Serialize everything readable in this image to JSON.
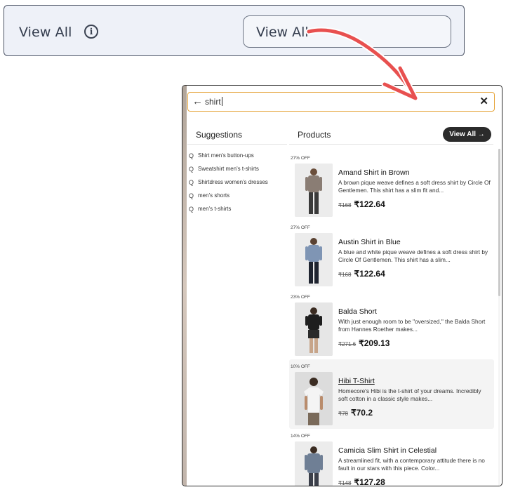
{
  "setting": {
    "label": "View All",
    "info_icon": "info-circle-icon",
    "preview_button_label": "View All"
  },
  "annotation": {
    "arrow_color": "#e8504f",
    "arrow_icon": "curved-arrow-icon"
  },
  "search": {
    "back_icon": "←",
    "value": "shirt",
    "clear_icon": "✕"
  },
  "suggestions": {
    "title": "Suggestions",
    "icon": "Q",
    "items": [
      "Shirt men's button-ups",
      "Sweatshirt men's t-shirts",
      "Shirtdress women's dresses",
      "men's shorts",
      "men's t-shirts"
    ]
  },
  "products": {
    "title": "Products",
    "view_all_label": "View All →",
    "items": [
      {
        "discount": "27% OFF",
        "name": "Amand Shirt in Brown",
        "desc": "A brown pique weave defines a soft dress shirt by Circle Of Gentlemen. This shirt has a slim fit and...",
        "old_price": "₹168",
        "new_price": "₹122.64",
        "shirt_color": "#8a7d74",
        "pants_color": "#3a3a3a"
      },
      {
        "discount": "27% OFF",
        "name": "Austin Shirt in Blue",
        "desc": "A blue and white pique weave defines a soft dress shirt by Circle Of Gentlemen. This shirt has a slim...",
        "old_price": "₹168",
        "new_price": "₹122.64",
        "shirt_color": "#7f95b4",
        "pants_color": "#1f2430"
      },
      {
        "discount": "23% OFF",
        "name": "Balda Short",
        "desc": "With just enough room to be \"oversized,\" the Balda Short from Hannes Roether makes...",
        "old_price": "₹271.6",
        "new_price": "₹209.13",
        "shirt_color": "#1e1e1e",
        "pants_color": "#2a2a2a"
      },
      {
        "discount": "10% OFF",
        "name": "Hibi T-Shirt",
        "desc": "Homecore's Hibi is the t-shirt of your dreams. Incredibly soft cotton in a classic style makes...",
        "old_price": "₹78",
        "new_price": "₹70.2",
        "shirt_color": "#e9e9e9",
        "pants_color": "#7a6a5a"
      },
      {
        "discount": "14% OFF",
        "name": "Camicia Slim Shirt in Celestial",
        "desc": "A streamlined fit, with a contemporary attitude there is no fault in our stars with this piece. Color...",
        "old_price": "₹148",
        "new_price": "₹127.28",
        "shirt_color": "#6f7f95",
        "pants_color": "#3b3f4a"
      }
    ]
  }
}
